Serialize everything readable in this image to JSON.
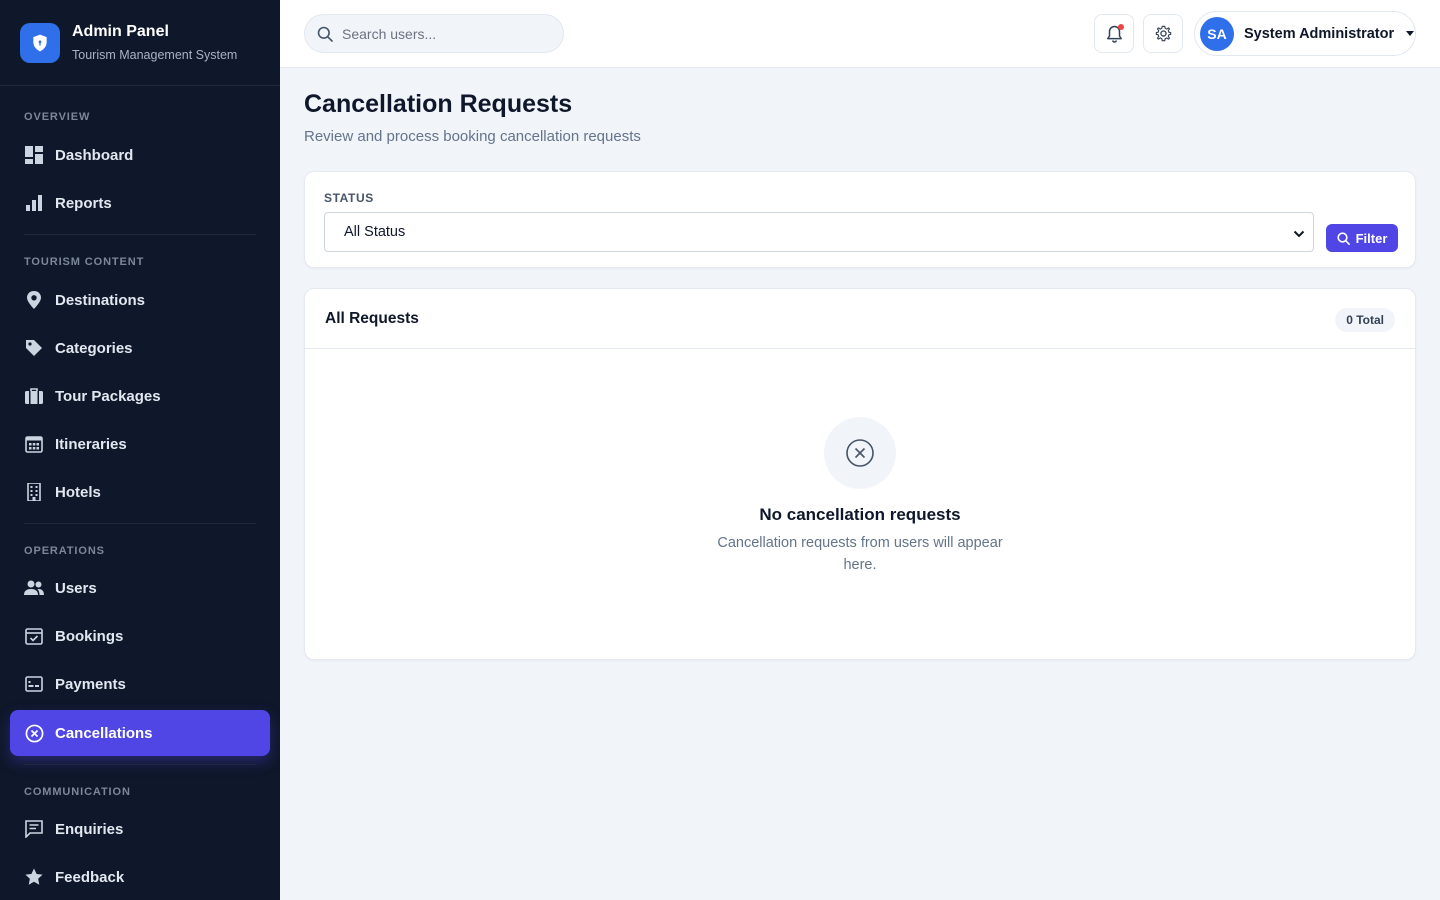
{
  "brand": {
    "title": "Admin Panel",
    "subtitle": "Tourism Management System"
  },
  "sidebar": {
    "sections": [
      {
        "label": "OVERVIEW",
        "items": [
          {
            "label": "Dashboard",
            "icon": "dashboard-icon"
          },
          {
            "label": "Reports",
            "icon": "bar-chart-icon"
          }
        ]
      },
      {
        "label": "TOURISM CONTENT",
        "items": [
          {
            "label": "Destinations",
            "icon": "map-pin-icon"
          },
          {
            "label": "Categories",
            "icon": "tag-icon"
          },
          {
            "label": "Tour Packages",
            "icon": "suitcase-icon"
          },
          {
            "label": "Itineraries",
            "icon": "calendar-grid-icon"
          },
          {
            "label": "Hotels",
            "icon": "building-icon"
          }
        ]
      },
      {
        "label": "OPERATIONS",
        "items": [
          {
            "label": "Users",
            "icon": "users-icon"
          },
          {
            "label": "Bookings",
            "icon": "calendar-check-icon"
          },
          {
            "label": "Payments",
            "icon": "card-icon"
          },
          {
            "label": "Cancellations",
            "icon": "x-circle-icon",
            "active": true
          }
        ]
      },
      {
        "label": "COMMUNICATION",
        "items": [
          {
            "label": "Enquiries",
            "icon": "message-icon"
          },
          {
            "label": "Feedback",
            "icon": "star-icon"
          }
        ]
      }
    ]
  },
  "topbar": {
    "search_placeholder": "Search users...",
    "user": {
      "initials": "SA",
      "name": "System Administrator"
    }
  },
  "page": {
    "title": "Cancellation Requests",
    "subtitle": "Review and process booking cancellation requests"
  },
  "filter": {
    "label": "STATUS",
    "selected": "All Status",
    "button": "Filter"
  },
  "requests": {
    "title": "All Requests",
    "total_badge": "0 Total",
    "empty_title": "No cancellation requests",
    "empty_text": "Cancellation requests from users will appear here."
  },
  "colors": {
    "sidebar_bg": "#0f172a",
    "accent": "#4f46e5",
    "brand_blue": "#2f6fea",
    "page_bg": "#f1f4f9"
  }
}
